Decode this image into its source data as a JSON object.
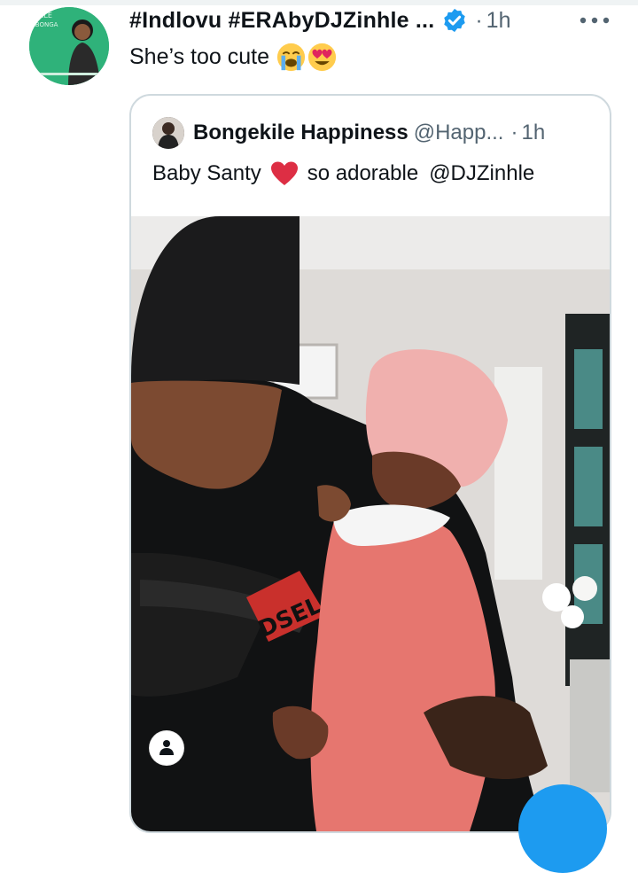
{
  "tweet": {
    "display_name": "#Indlovu #ERAbyDJZinhle ...",
    "dot": "·",
    "time": "1h",
    "text": "She’s too cute",
    "emojis": [
      "crying-face",
      "heart-eyes-face"
    ],
    "avatar_text": {
      "line1": "INHLE",
      "line2": "ABONGA"
    }
  },
  "quoted_tweet": {
    "display_name": "Bongekile Happiness",
    "handle": "@Happ...",
    "dot": "·",
    "time": "1h",
    "text_before": "Baby Santy",
    "text_after": "so adorable",
    "mention": "@DJZinhle"
  },
  "photo": {
    "shirt_text": "DSEL"
  },
  "colors": {
    "accent": "#1d9bf0",
    "text": "#0f1419",
    "secondary_text": "#536471",
    "border": "#cfd9de",
    "heart": "#e0245e"
  }
}
